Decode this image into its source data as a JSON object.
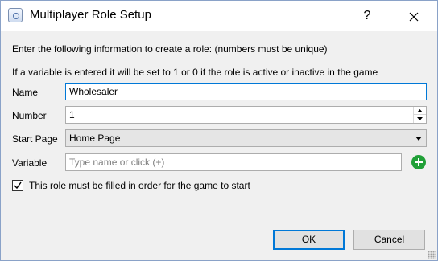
{
  "window": {
    "title": "Multiplayer Role Setup",
    "help_label": "?"
  },
  "intro": {
    "line1": "Enter the following information to create a role: (numbers must be unique)",
    "line2": "If a variable is entered it will be set to 1 or 0 if the role is active or inactive in the game"
  },
  "form": {
    "name": {
      "label": "Name",
      "value": "Wholesaler"
    },
    "number": {
      "label": "Number",
      "value": "1"
    },
    "start_page": {
      "label": "Start Page",
      "value": "Home Page"
    },
    "variable": {
      "label": "Variable",
      "value": "",
      "placeholder": "Type name or click (+)"
    }
  },
  "checkbox": {
    "label": "This role must be filled in order for the game to start",
    "checked": true
  },
  "buttons": {
    "ok": "OK",
    "cancel": "Cancel"
  },
  "colors": {
    "focus_border": "#0078d7",
    "add_button": "#21a038"
  },
  "icons": {
    "app": "app-icon",
    "close": "close-icon",
    "add": "add-circle-icon",
    "check": "check-icon",
    "dropdown": "chevron-down-icon"
  }
}
